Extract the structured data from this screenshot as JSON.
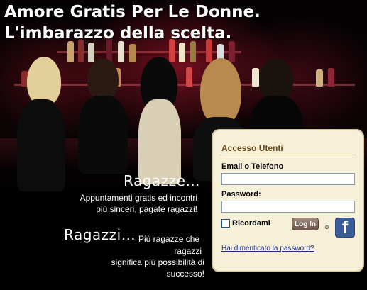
{
  "headline": "Amore Gratis Per Le Donne. L'imbarazzo della scelta.",
  "girls": {
    "title": "Ragazze…",
    "line1": "Appuntamenti gratis ed incontri",
    "line2": "più sinceri, pagate ragazzi!"
  },
  "boys": {
    "title": "Ragazzi…",
    "line1": "Più ragazze che",
    "line2": "ragazzi",
    "line3": "significa più possibilità di",
    "line4": "successo!"
  },
  "login": {
    "title": "Accesso Utenti",
    "email_label": "Email o Telefono",
    "email_value": "",
    "password_label": "Password:",
    "password_value": "",
    "remember_label": "Ricordami",
    "login_button": "Log In",
    "or_text": "o",
    "facebook_letter": "f",
    "forgot_link": "Hai dimenticato la password?"
  },
  "colors": {
    "panel_bg": "#f6f0d9",
    "panel_border": "#d1c49a",
    "title_brown": "#6b4a1a",
    "link_blue": "#1f2f8a",
    "facebook_blue": "#3b5a9a"
  },
  "icons": [
    "facebook-icon",
    "checkbox"
  ]
}
